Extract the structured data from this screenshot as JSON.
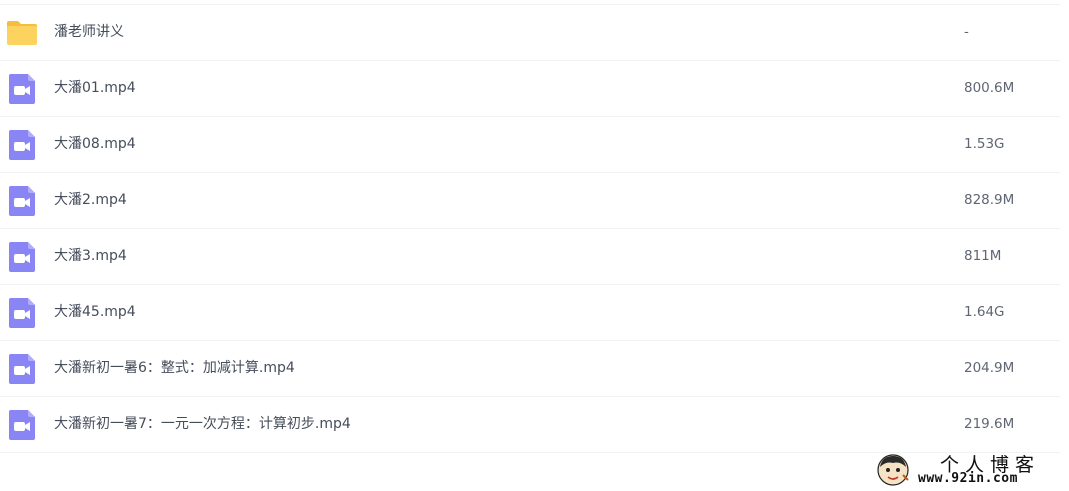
{
  "file_list": {
    "items": [
      {
        "type": "folder",
        "icon": "folder-icon",
        "name": "潘老师讲义",
        "size": "-"
      },
      {
        "type": "video",
        "icon": "video-file-icon",
        "name": "大潘01.mp4",
        "size": "800.6M"
      },
      {
        "type": "video",
        "icon": "video-file-icon",
        "name": "大潘08.mp4",
        "size": "1.53G"
      },
      {
        "type": "video",
        "icon": "video-file-icon",
        "name": "大潘2.mp4",
        "size": "828.9M"
      },
      {
        "type": "video",
        "icon": "video-file-icon",
        "name": "大潘3.mp4",
        "size": "811M"
      },
      {
        "type": "video",
        "icon": "video-file-icon",
        "name": "大潘45.mp4",
        "size": "1.64G"
      },
      {
        "type": "video",
        "icon": "video-file-icon",
        "name": "大潘新初一暑6：整式：加减计算.mp4",
        "size": "204.9M"
      },
      {
        "type": "video",
        "icon": "video-file-icon",
        "name": "大潘新初一暑7：一元一次方程：计算初步.mp4",
        "size": "219.6M"
      }
    ]
  },
  "watermark": {
    "title": "个人博客",
    "url": "www.92in.com"
  },
  "colors": {
    "folder": "#fdd35f",
    "folder_tab": "#f5bf3d",
    "video": "#8a85f5",
    "text": "#454d5a",
    "divider": "#f1f2f4"
  }
}
